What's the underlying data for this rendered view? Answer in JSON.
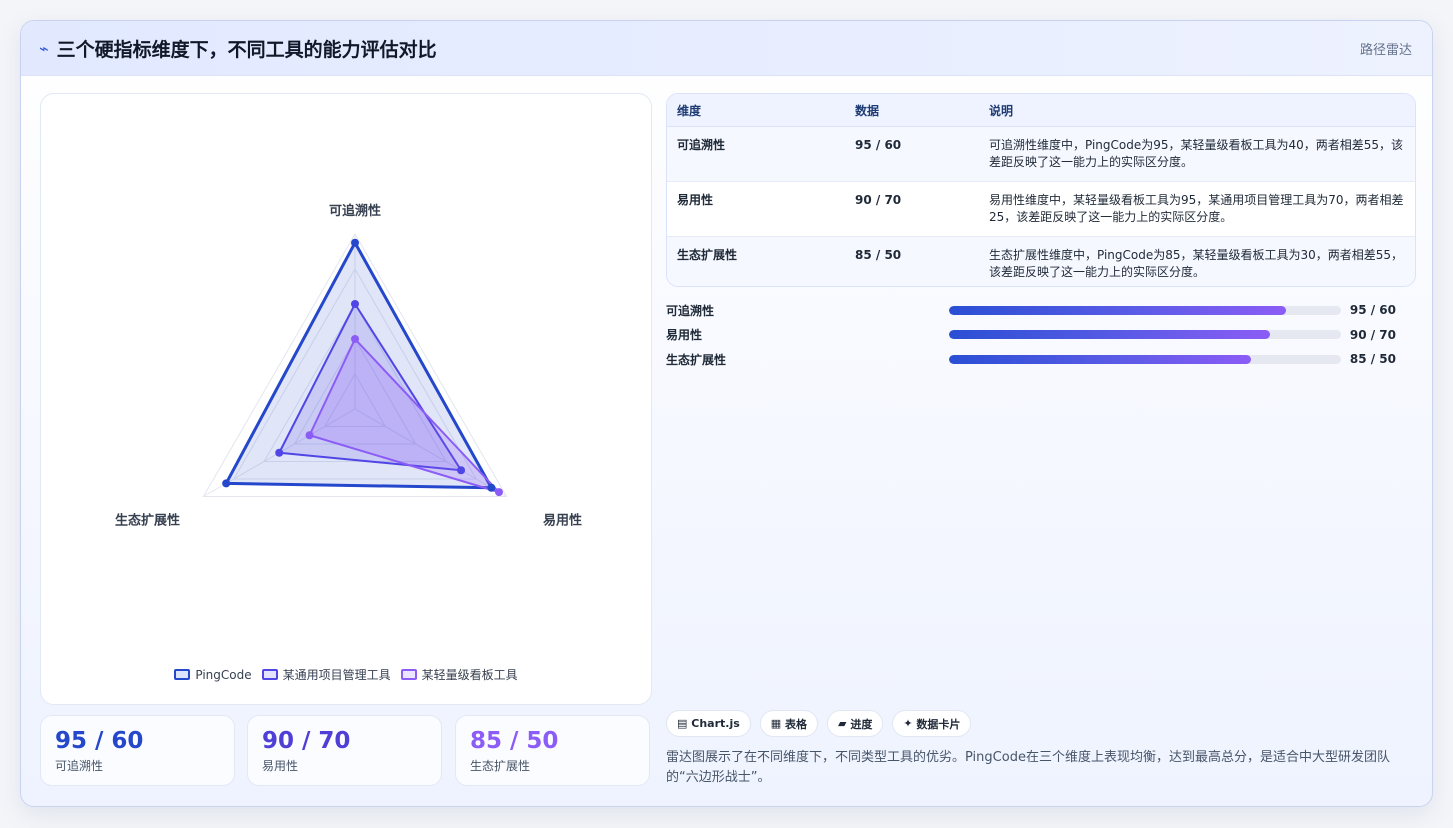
{
  "header": {
    "icon": "bolt-icon",
    "title": "三个硬指标维度下，不同工具的能力评估对比",
    "tag": "路径雷达"
  },
  "chart_data": {
    "type": "radar",
    "axes": [
      "可追溯性",
      "易用性",
      "生态扩展性"
    ],
    "range": [
      0,
      100
    ],
    "grid_levels": 5,
    "series": [
      {
        "name": "PingCode",
        "values": [
          95,
          90,
          85
        ],
        "color": "#2447cc"
      },
      {
        "name": "某通用项目管理工具",
        "values": [
          60,
          70,
          50
        ],
        "color": "#4f46e5"
      },
      {
        "name": "某轻量级看板工具",
        "values": [
          40,
          95,
          30
        ],
        "color": "#8b5cf6"
      }
    ]
  },
  "stats": [
    {
      "value": "95 / 60",
      "label": "可追溯性",
      "color": "#2447cc"
    },
    {
      "value": "90 / 70",
      "label": "易用性",
      "color": "#4f3fd6"
    },
    {
      "value": "85 / 50",
      "label": "生态扩展性",
      "color": "#8b5cf6"
    }
  ],
  "table": {
    "headers": [
      "维度",
      "数据",
      "说明"
    ],
    "rows": [
      {
        "dim": "可追溯性",
        "data": "95 / 60",
        "desc": "可追溯性维度中，PingCode为95，某轻量级看板工具为40，两者相差55，该差距反映了这一能力上的实际区分度。"
      },
      {
        "dim": "易用性",
        "data": "90 / 70",
        "desc": "易用性维度中，某轻量级看板工具为95，某通用项目管理工具为70，两者相差25，该差距反映了这一能力上的实际区分度。"
      },
      {
        "dim": "生态扩展性",
        "data": "85 / 50",
        "desc": "生态扩展性维度中，PingCode为85，某轻量级看板工具为30，两者相差55，该差距反映了这一能力上的实际区分度。"
      }
    ]
  },
  "bars": [
    {
      "label": "可追溯性",
      "percent": 86,
      "value": "95 / 60"
    },
    {
      "label": "易用性",
      "percent": 82,
      "value": "90 / 70"
    },
    {
      "label": "生态扩展性",
      "percent": 77,
      "value": "85 / 50"
    }
  ],
  "chips": [
    {
      "icon": "chart-icon",
      "glyph": "▤",
      "label": "Chart.js"
    },
    {
      "icon": "table-icon",
      "glyph": "▦",
      "label": "表格"
    },
    {
      "icon": "progress-icon",
      "glyph": "▰",
      "label": "进度"
    },
    {
      "icon": "sparkle-icon",
      "glyph": "✦",
      "label": "数据卡片"
    }
  ],
  "summary": "雷达图展示了在不同维度下，不同类型工具的优劣。PingCode在三个维度上表现均衡，达到最高总分，是适合中大型研发团队的“六边形战士”。"
}
